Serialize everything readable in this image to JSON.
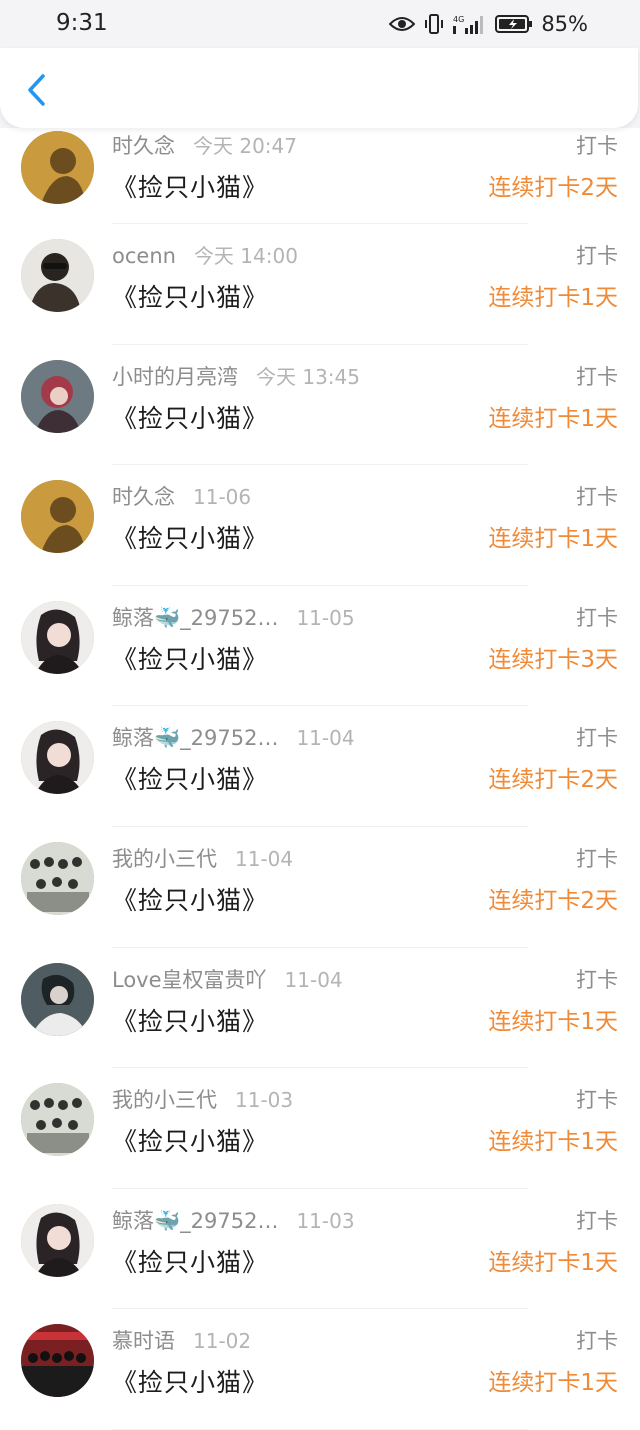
{
  "status_bar": {
    "time": "9:31",
    "network": "4G",
    "battery": "85%",
    "icons": [
      "eye-icon",
      "vibrate-icon",
      "signal-icon",
      "battery-icon"
    ]
  },
  "header": {
    "back_icon": "chevron-left-icon",
    "accent_color": "#2196f3"
  },
  "colors": {
    "streak": "#f08a37",
    "muted_text": "#8d8d8d",
    "date_text": "#b4b4b4"
  },
  "records": [
    {
      "user": "时久念",
      "date": "今天 20:47",
      "title": "《捡只小猫》",
      "tag": "打卡",
      "streak": "连续打卡2天",
      "avatar_color": "#c99a3e"
    },
    {
      "user": "ocenn",
      "date": "今天 14:00",
      "title": "《捡只小猫》",
      "tag": "打卡",
      "streak": "连续打卡1天",
      "avatar_color": "#5a4f44"
    },
    {
      "user": "小时的月亮湾",
      "date": "今天 13:45",
      "title": "《捡只小猫》",
      "tag": "打卡",
      "streak": "连续打卡1天",
      "avatar_color": "#7a4a55"
    },
    {
      "user": "时久念",
      "date": "11-06",
      "title": "《捡只小猫》",
      "tag": "打卡",
      "streak": "连续打卡1天",
      "avatar_color": "#c99a3e"
    },
    {
      "user": "鲸落🐳_29752…",
      "date": "11-05",
      "title": "《捡只小猫》",
      "tag": "打卡",
      "streak": "连续打卡3天",
      "avatar_color": "#4a4042"
    },
    {
      "user": "鲸落🐳_29752…",
      "date": "11-04",
      "title": "《捡只小猫》",
      "tag": "打卡",
      "streak": "连续打卡2天",
      "avatar_color": "#4a4042"
    },
    {
      "user": "我的小三代",
      "date": "11-04",
      "title": "《捡只小猫》",
      "tag": "打卡",
      "streak": "连续打卡2天",
      "avatar_color": "#8c8f88"
    },
    {
      "user": "Love皇权富贵吖",
      "date": "11-04",
      "title": "《捡只小猫》",
      "tag": "打卡",
      "streak": "连续打卡1天",
      "avatar_color": "#5d6a6e"
    },
    {
      "user": "我的小三代",
      "date": "11-03",
      "title": "《捡只小猫》",
      "tag": "打卡",
      "streak": "连续打卡1天",
      "avatar_color": "#8c8f88"
    },
    {
      "user": "鲸落🐳_29752…",
      "date": "11-03",
      "title": "《捡只小猫》",
      "tag": "打卡",
      "streak": "连续打卡1天",
      "avatar_color": "#4a4042"
    },
    {
      "user": "慕时语",
      "date": "11-02",
      "title": "《捡只小猫》",
      "tag": "打卡",
      "streak": "连续打卡1天",
      "avatar_color": "#6e2a2a"
    }
  ]
}
